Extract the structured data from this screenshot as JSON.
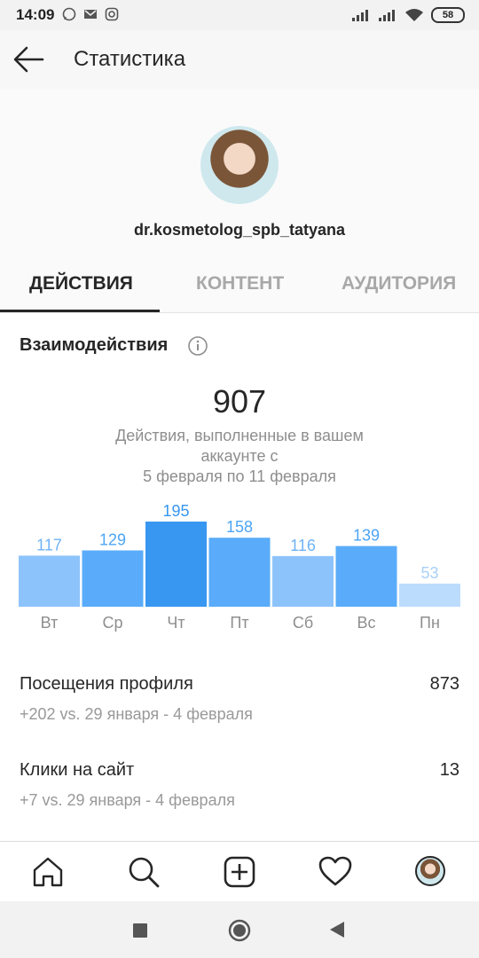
{
  "status_bar": {
    "time": "14:09",
    "battery": "58",
    "notification_icons": [
      "whatsapp-icon",
      "gmail-icon",
      "instagram-icon"
    ]
  },
  "header": {
    "title": "Статистика"
  },
  "profile": {
    "username": "dr.kosmetolog_spb_tatyana"
  },
  "tabs": [
    {
      "label": "ДЕЙСТВИЯ",
      "active": true
    },
    {
      "label": "КОНТЕНТ",
      "active": false
    },
    {
      "label": "АУДИТОРИЯ",
      "active": false
    }
  ],
  "interactions": {
    "title": "Взаимодействия",
    "total": "907",
    "caption_line1": "Действия, выполненные в вашем",
    "caption_line2": "аккаунте с",
    "caption_line3": "5 февраля по 11 февраля"
  },
  "chart_data": {
    "type": "bar",
    "categories": [
      "Вт",
      "Ср",
      "Чт",
      "Пт",
      "Сб",
      "Вс",
      "Пн"
    ],
    "values": [
      117,
      129,
      195,
      158,
      116,
      139,
      53
    ],
    "colors": [
      "#8dc3fb",
      "#5aacfa",
      "#3897f0",
      "#5aacfa",
      "#8dc3fb",
      "#5aacfa",
      "#bcdcfd"
    ],
    "label_colors": [
      "#6fb3f6",
      "#4da5f5",
      "#3897f0",
      "#4da5f5",
      "#6fb3f6",
      "#4da5f5",
      "#a8d0f7"
    ]
  },
  "stats": [
    {
      "label": "Посещения профиля",
      "value": "873",
      "sub": "+202 vs. 29 января - 4 февраля"
    },
    {
      "label": "Клики на сайт",
      "value": "13",
      "sub": "+7 vs. 29 января - 4 февраля"
    }
  ],
  "bottom_nav": [
    "home-icon",
    "search-icon",
    "add-post-icon",
    "activity-heart-icon",
    "profile-avatar"
  ],
  "android_nav": [
    "recents-icon",
    "home-circle-icon",
    "back-triangle-icon"
  ]
}
